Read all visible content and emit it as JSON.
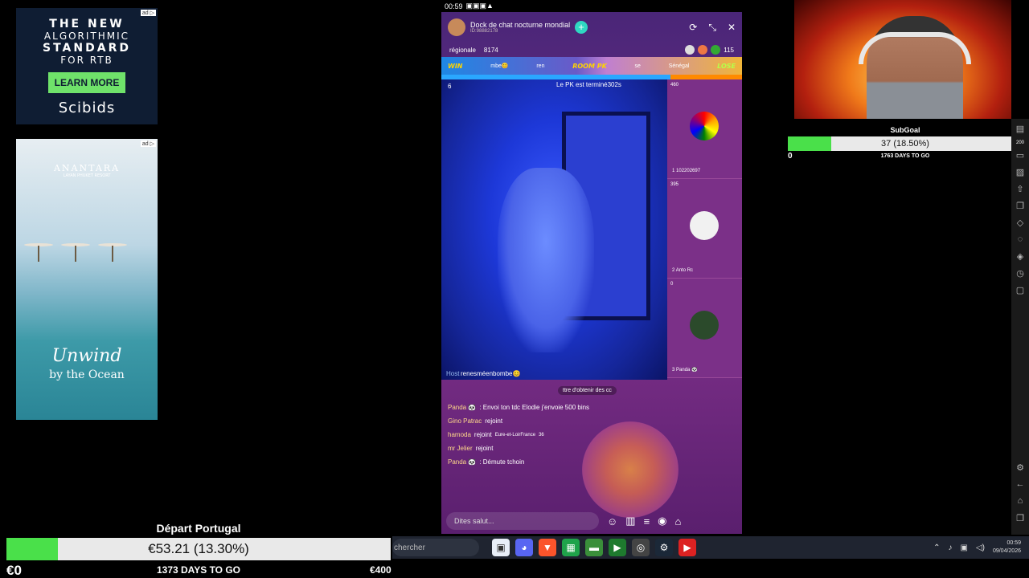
{
  "ads": {
    "scibids": {
      "line1": "THE NEW",
      "line2": "ALGORITHMIC",
      "line3": "STANDARD",
      "line4": "FOR RTB",
      "cta": "LEARN MORE",
      "brand": "Scibids"
    },
    "anantara": {
      "logo": "ANANTARA",
      "sub": "LAYAN PHUKET RESORT",
      "tagline1": "Unwind",
      "tagline2": "by the Ocean"
    },
    "adchoice": "ad ▷"
  },
  "status_top": {
    "time": "00:59"
  },
  "room": {
    "title": "Dock de chat nocturne mondial",
    "id": "ID:98882178",
    "region": "régionale",
    "coins": "8174",
    "viewer_count": "115",
    "pk_left": "mbe😊",
    "pk_left2": "ren",
    "pk_label": "ROOM PK",
    "pk_right": "se",
    "pk_right_country": "Sénégal",
    "lose": "LOSE",
    "win": "WIN",
    "pk_status": "Le PK est terminé302s",
    "host_tag": "Host",
    "host_name": "renesméenbombe😊",
    "host_score": "6",
    "seats": [
      {
        "score": "460",
        "rank": "1",
        "name": "102202697"
      },
      {
        "score": "395",
        "rank": "2",
        "name": "Anto Rc"
      },
      {
        "score": "0",
        "rank": "3",
        "name": "Panda 🐼"
      }
    ]
  },
  "chat": {
    "hint": "ttre d'obtenir des cc",
    "messages": [
      {
        "who": "Panda 🐼",
        "text": ": Envoi ton tdc Elodie j'envoie 500 bins"
      },
      {
        "who": "Gino Patrac",
        "text": "rejoint"
      },
      {
        "who": "hamoda",
        "text": "rejoint",
        "extra": "Eure-et-LoirFrance",
        "num": "36"
      },
      {
        "who": "mr Jelier",
        "text": "rejoint"
      },
      {
        "who": "Panda 🐼",
        "text": ": Démute tchoin"
      }
    ],
    "input_placeholder": "Dites salut..."
  },
  "subgoal": {
    "title": "SubGoal",
    "text": "37 (18.50%)",
    "low": "0",
    "high": "200",
    "days": "1763 DAYS TO GO",
    "fraction": 0.185
  },
  "goal": {
    "title": "Départ Portugal",
    "text": "€53.21 (13.30%)",
    "low": "€0",
    "high": "€400",
    "days": "1373 DAYS TO GO",
    "fraction": 0.133
  },
  "taskbar": {
    "search": "chercher",
    "time": "00:59",
    "date": "09/04/2026"
  }
}
